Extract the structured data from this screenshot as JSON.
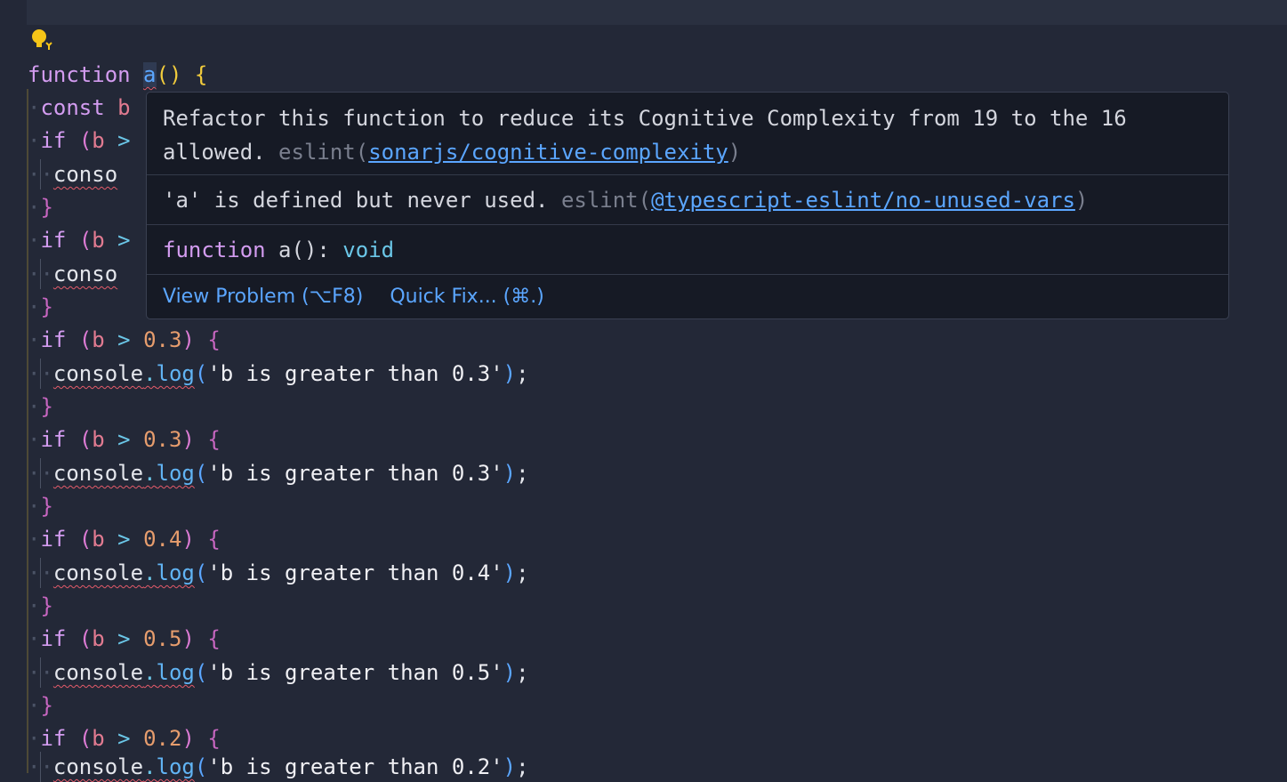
{
  "code": {
    "line1": {
      "kw": "function",
      "name": "a",
      "rest": "()",
      "brace": "{"
    },
    "line2": {
      "kw": "const",
      "var": "b"
    },
    "if_kw": "if",
    "var_b": "b",
    "gt": ">",
    "open_brace": "{",
    "close_brace": "}",
    "console": "console",
    "dot": ".",
    "log": "log",
    "semi": ";",
    "partial_console": "conso",
    "blocks": [
      {
        "num": "0.3",
        "msg": "'b is greater than 0.3'"
      },
      {
        "num": "0.3",
        "msg": "'b is greater than 0.3'"
      },
      {
        "num": "0.4",
        "msg": "'b is greater than 0.4'"
      },
      {
        "num": "0.5",
        "msg": "'b is greater than 0.5'"
      },
      {
        "num": "0.2",
        "msg": "'b is greater than 0.2'"
      }
    ]
  },
  "hover": {
    "problem1": {
      "line1": "Refactor this function to reduce its Cognitive Complexity from 19 to the 16",
      "line2": "allowed.",
      "source": "eslint(",
      "rule": "sonarjs/cognitive-complexity",
      "close": ")"
    },
    "problem2": {
      "text": "'a' is defined but never used.",
      "source": "eslint(",
      "rule": "@typescript-eslint/no-unused-vars",
      "close": ")"
    },
    "signature": {
      "kw": "function",
      "name": "a():",
      "type": "void"
    },
    "actions": {
      "view_problem": "View Problem (⌥F8)",
      "quick_fix": "Quick Fix... (⌘.)"
    }
  }
}
